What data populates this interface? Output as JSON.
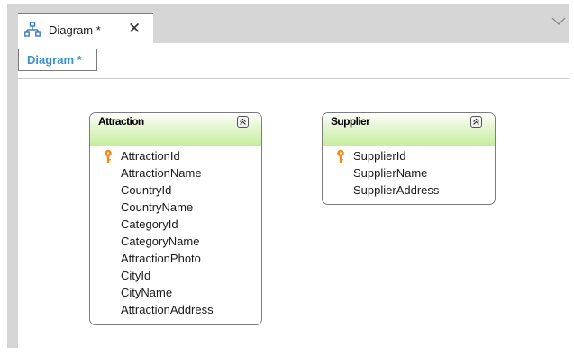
{
  "tab": {
    "title": "Diagram *",
    "close_glyph": "✕",
    "icon": "diagram-icon"
  },
  "subtab": {
    "label": "Diagram *"
  },
  "entities": [
    {
      "title": "Attraction",
      "key_attribute": "AttractionId",
      "attributes": [
        "AttractionId",
        "AttractionName",
        "CountryId",
        "CountryName",
        "CategoryId",
        "CategoryName",
        "AttractionPhoto",
        "CityId",
        "CityName",
        "AttractionAddress"
      ]
    },
    {
      "title": "Supplier",
      "key_attribute": "SupplierId",
      "attributes": [
        "SupplierId",
        "SupplierName",
        "SupplierAddress"
      ]
    }
  ],
  "colors": {
    "accent": "#3b8fcf",
    "tab_border": "#4a86c8",
    "header_green": "#c6ee9e",
    "key_orange": "#f08c1c",
    "frame_gray": "#d6d6d6"
  }
}
